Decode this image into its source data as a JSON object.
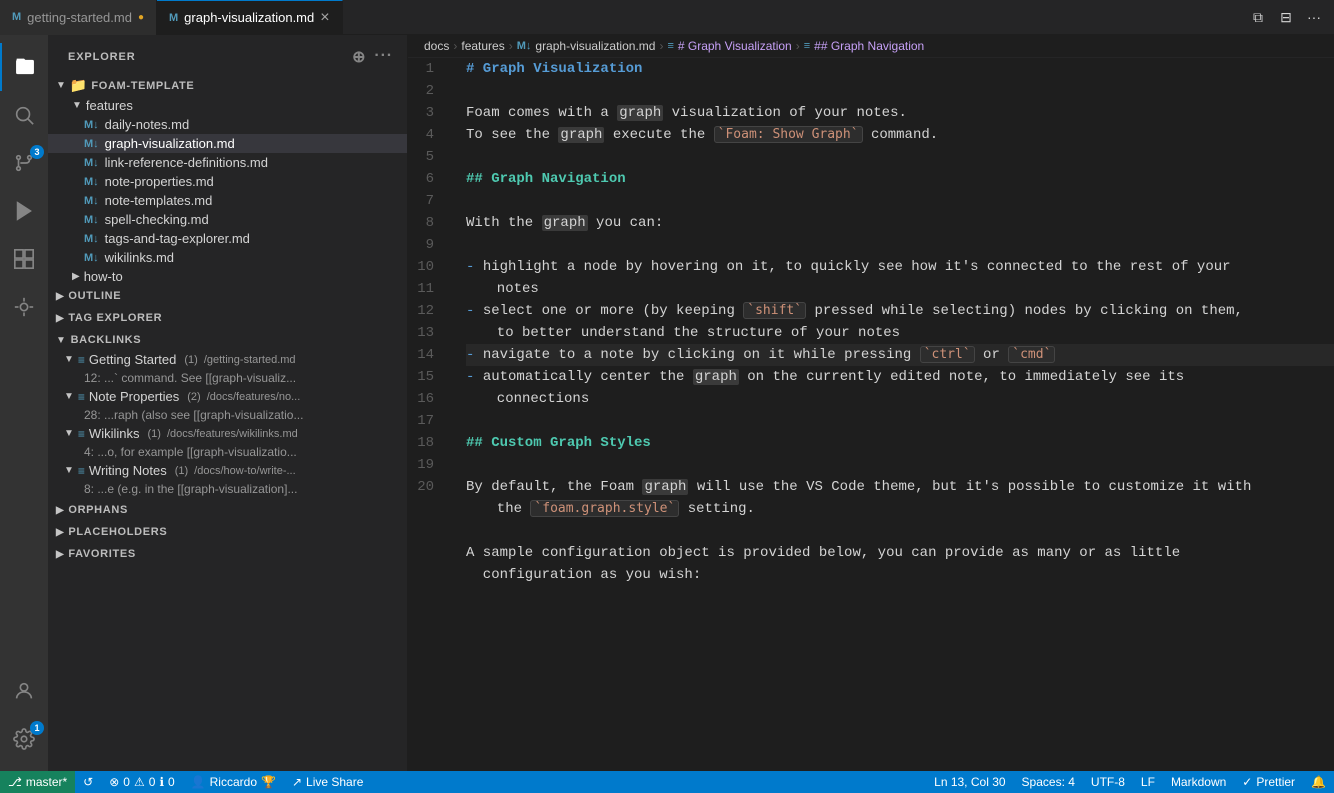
{
  "tabs": [
    {
      "label": "getting-started.md",
      "modified": true,
      "active": false,
      "icon": "M"
    },
    {
      "label": "graph-visualization.md",
      "modified": false,
      "active": true,
      "icon": "×"
    }
  ],
  "breadcrumb": {
    "items": [
      "docs",
      "features",
      "graph-visualization.md",
      "# Graph Visualization",
      "## Graph Navigation"
    ]
  },
  "sidebar": {
    "title": "EXPLORER",
    "root_folder": "FOAM-TEMPLATE",
    "features_folder": "features",
    "files": [
      "daily-notes.md",
      "graph-visualization.md",
      "link-reference-definitions.md",
      "note-properties.md",
      "note-templates.md",
      "spell-checking.md",
      "tags-and-tag-explorer.md",
      "wikilinks.md"
    ],
    "how_to_folder": "how-to",
    "sections": [
      {
        "label": "OUTLINE",
        "expanded": false
      },
      {
        "label": "TAG EXPLORER",
        "expanded": false
      },
      {
        "label": "BACKLINKS",
        "expanded": true
      },
      {
        "label": "ORPHANS",
        "expanded": false
      },
      {
        "label": "PLACEHOLDERS",
        "expanded": false
      },
      {
        "label": "FAVORITES",
        "expanded": false
      }
    ],
    "backlinks": [
      {
        "label": "Getting Started",
        "count": "(1)",
        "path": "/getting-started.md",
        "sub": "12: ...` command. See [[graph-visualiz..."
      },
      {
        "label": "Note Properties",
        "count": "(2)",
        "path": "/docs/features/no...",
        "sub": "28: ...raph (also see [[graph-visualizatio..."
      },
      {
        "label": "Wikilinks",
        "count": "(1)",
        "path": "/docs/features/wikilinks.md",
        "sub": "4: ...o, for example [[graph-visualizatio..."
      },
      {
        "label": "Writing Notes",
        "count": "(1)",
        "path": "/docs/how-to/write-...",
        "sub": "8: ...e (e.g. in the [[graph-visualization]..."
      }
    ]
  },
  "editor": {
    "lines": [
      {
        "num": 1,
        "content": "h1_graph_viz",
        "type": "h1",
        "text": "# Graph Visualization"
      },
      {
        "num": 2,
        "content": "",
        "type": "empty"
      },
      {
        "num": 3,
        "content": "line3",
        "type": "text",
        "text": "Foam comes with a graph visualization of your notes."
      },
      {
        "num": 4,
        "content": "line4",
        "type": "text_code",
        "text": "To see the graph execute the ",
        "code": "`Foam: Show Graph`",
        "after": " command."
      },
      {
        "num": 5,
        "content": "",
        "type": "empty"
      },
      {
        "num": 6,
        "content": "h2_graph_nav",
        "type": "h2",
        "text": "## Graph Navigation"
      },
      {
        "num": 7,
        "content": "",
        "type": "empty"
      },
      {
        "num": 8,
        "content": "line8",
        "type": "text",
        "text": "With the graph you can:"
      },
      {
        "num": 9,
        "content": "",
        "type": "empty"
      },
      {
        "num": 10,
        "content": "line10",
        "type": "bullet_long",
        "text": "- highlight a node by hovering on it, to quickly see how it's connected to the rest of your",
        "continuation": "  notes"
      },
      {
        "num": 11,
        "content": "line11",
        "type": "bullet_code2",
        "before": "- select one or more (by keeping ",
        "code1": "`shift`",
        "middle": " pressed while selecting) nodes by clicking on them,",
        "continuation": "  to better understand the structure of your notes"
      },
      {
        "num": 12,
        "content": "line12",
        "type": "bullet_code2",
        "before": "- navigate to a note by clicking on it while pressing ",
        "code1": "`ctrl`",
        "middle": " or ",
        "code2": "`cmd`"
      },
      {
        "num": 13,
        "content": "line13",
        "type": "bullet_long2",
        "text": "- automatically center the graph on the currently edited note, to immediately see its",
        "continuation": "  connections"
      },
      {
        "num": 14,
        "content": "",
        "type": "empty"
      },
      {
        "num": 15,
        "content": "h2_custom",
        "type": "h2",
        "text": "## Custom Graph Styles"
      },
      {
        "num": 16,
        "content": "",
        "type": "empty"
      },
      {
        "num": 17,
        "content": "line17",
        "type": "text_code2",
        "before": "By default, the Foam graph will use the VS Code theme, but it's possible to customize it with",
        "continuation_before": "the ",
        "code": "`foam.graph.style`",
        "after": " setting."
      },
      {
        "num": 18,
        "content": "",
        "type": "empty"
      },
      {
        "num": 19,
        "content": "line19",
        "type": "text",
        "text": "A sample configuration object is provided below, you can provide as many or as little"
      },
      {
        "num": 20,
        "content": "line19b",
        "type": "text",
        "text": "  configuration as you wish:"
      }
    ]
  },
  "status_bar": {
    "branch": "master*",
    "sync_icon": "↺",
    "errors": "0",
    "warnings": "0",
    "info": "0",
    "user": "Riccardo",
    "live_share": "Live Share",
    "cursor": "Ln 13, Col 30",
    "spaces": "Spaces: 4",
    "encoding": "UTF-8",
    "line_ending": "LF",
    "language": "Markdown",
    "formatter": "Prettier",
    "notification": "🔔"
  },
  "activity_bar": {
    "items": [
      {
        "icon": "files",
        "active": true
      },
      {
        "icon": "search",
        "active": false
      },
      {
        "icon": "git",
        "active": false,
        "badge": "3"
      },
      {
        "icon": "debug",
        "active": false
      },
      {
        "icon": "extensions",
        "active": false
      },
      {
        "icon": "foam",
        "active": false
      }
    ],
    "bottom": [
      {
        "icon": "account"
      },
      {
        "icon": "settings",
        "badge": "1"
      }
    ]
  }
}
